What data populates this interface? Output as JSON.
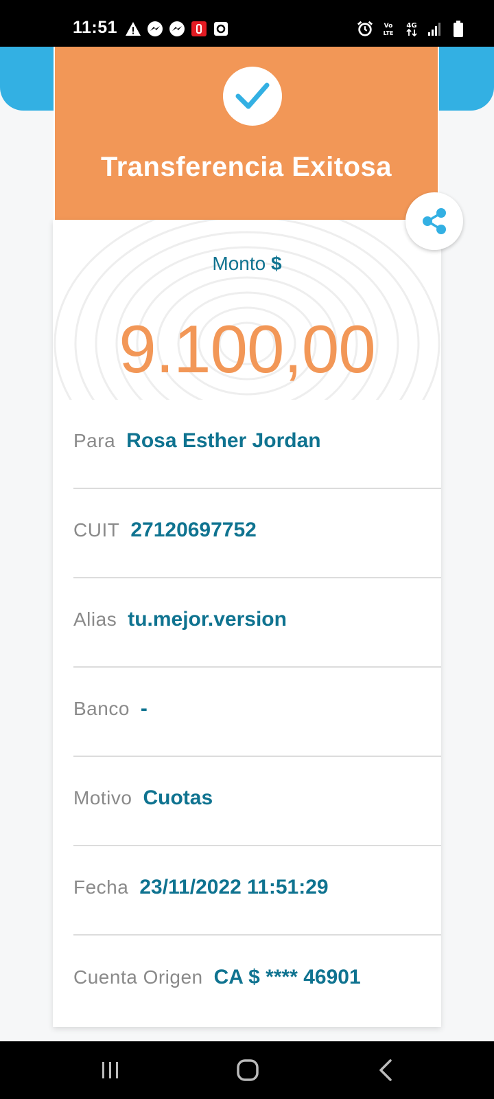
{
  "status_bar": {
    "time": "11:51",
    "left_icons": [
      "warning-icon",
      "messenger-icon",
      "messenger-icon",
      "app-notification-icon",
      "screen-record-icon"
    ],
    "right_icons": [
      "alarm-icon",
      "volte-icon",
      "network-4g-icon",
      "signal-icon",
      "battery-icon"
    ],
    "volte_text": "Vo LTE",
    "network_text": "4G"
  },
  "header": {
    "title": "Transferencia Exitosa",
    "check_icon": "checkmark-icon",
    "share_icon": "share-icon"
  },
  "amount": {
    "label": "Monto",
    "currency": "$",
    "value": "9.100,00"
  },
  "details": [
    {
      "label": "Para",
      "value": "Rosa Esther Jordan"
    },
    {
      "label": "CUIT",
      "value": "27120697752"
    },
    {
      "label": "Alias",
      "value": "tu.mejor.version"
    },
    {
      "label": "Banco",
      "value": "-"
    },
    {
      "label": "Motivo",
      "value": "Cuotas"
    },
    {
      "label": "Fecha",
      "value": "23/11/2022 11:51:29"
    },
    {
      "label": "Cuenta Origen",
      "value": "CA $ **** 46901"
    }
  ],
  "nav_bar": {
    "buttons": [
      "recent-apps-icon",
      "home-icon",
      "back-icon"
    ]
  },
  "colors": {
    "accent_orange": "#f29757",
    "accent_blue": "#33b0e3",
    "value_teal": "#0f7390",
    "label_gray": "#8a8a8a"
  }
}
